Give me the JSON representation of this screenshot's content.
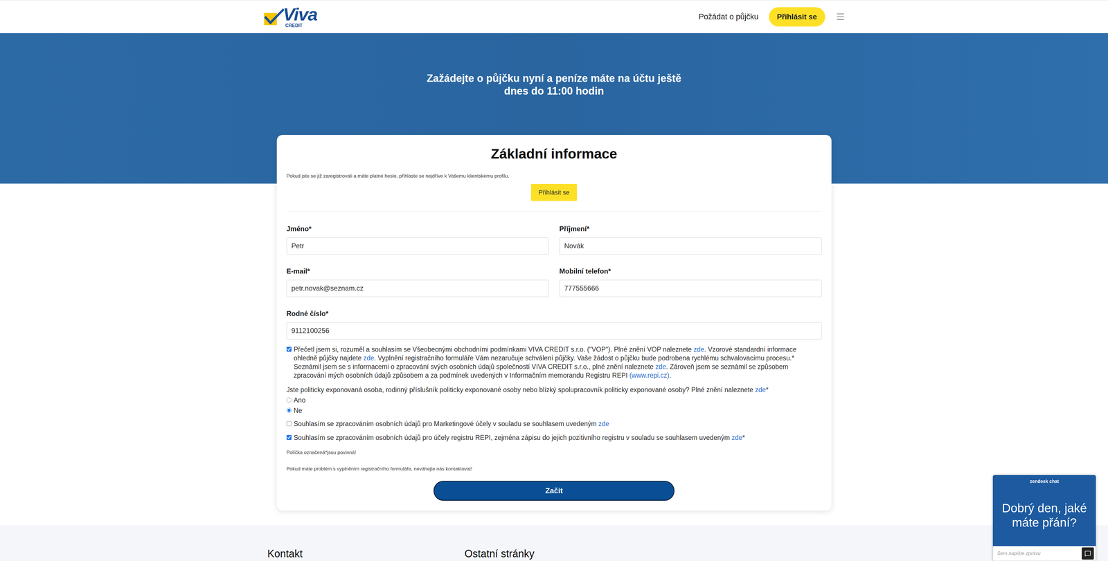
{
  "header": {
    "logo": {
      "name": "Viva",
      "sub": "CREDIT"
    },
    "nav": [
      {
        "label": "Požádat o půjčku"
      }
    ],
    "login_button": "Přihlásit se"
  },
  "hero": {
    "title_lines": [
      "Zažádejte o půjčku nyní a peníze máte na účtu ještě",
      "dnes do 11:00 hodin"
    ]
  },
  "form": {
    "title": "Základní informace",
    "login_hint": "Pokud jste se již zaregistrovali a máte platné heslo, přihlaste se nejdříve k Vašemu klientskému profilu.",
    "login_button": "Přihlásit se",
    "field_rows": [
      [
        {
          "label": "Jméno*",
          "value": "Petr"
        },
        {
          "label": "Příjmení*",
          "value": "Novák"
        }
      ],
      [
        {
          "label": "E-mail*",
          "value": "petr.novak@seznam.cz"
        },
        {
          "label": "Mobilní telefon*",
          "value": "777555666"
        }
      ],
      [
        {
          "label": "Rodné číslo*",
          "value": "9112100256"
        }
      ]
    ],
    "terms": {
      "checked": true,
      "paragraphs": [
        [
          {
            "text": "Přečetl jsem si, rozuměl a souhlasím se Všeobecnými obchodními podmínkami VIVA CREDIT s.r.o. (\"VOP\"). Plné znění VOP naleznete ",
            "link": false
          },
          {
            "text": "zde",
            "link": true
          },
          {
            "text": ". Vzorové standardní informace ohledně půjčky najdete ",
            "link": false
          },
          {
            "text": "zde",
            "link": true
          },
          {
            "text": ". Vyplnění registračního formuláře Vám nezaručuje schválení půjčky. Vaše žádost o půjčku bude podrobena rychlému schvalovacímu procesu.*",
            "link": false
          }
        ],
        [
          {
            "text": "Seznámil jsem se s informacemi o zpracování svých osobních údajů společností VIVA CREDIT s.r.o., plné znění naleznete ",
            "link": false
          },
          {
            "text": "zde",
            "link": true
          },
          {
            "text": ". Zároveň jsem se seznámil se způsobem zpracování mých osobních údajů způsobem a za podmínek uvedených v Informačním memorandu Registru REPI ",
            "link": false
          },
          {
            "text": "(www.repi.cz)",
            "link": true
          },
          {
            "text": ".",
            "link": false
          }
        ]
      ]
    },
    "pep": {
      "question": [
        {
          "text": "Jste politicky exponovaná osoba, rodinný příslušník politicky exponované osoby nebo blízký spolupracovník politicky exponované osoby? Plné znění naleznete ",
          "link": false
        },
        {
          "text": "zde",
          "link": true
        },
        {
          "text": "*",
          "link": false
        }
      ],
      "options": [
        {
          "label": "Ano",
          "selected": false
        },
        {
          "label": "Ne",
          "selected": true
        }
      ]
    },
    "consents": [
      {
        "checked": false,
        "parts": [
          {
            "text": "Souhlasím se zpracováním osobních údajů pro Marketingové účely v souladu se souhlasem uvedeným ",
            "link": false
          },
          {
            "text": "zde",
            "link": true
          }
        ]
      },
      {
        "checked": true,
        "parts": [
          {
            "text": "Souhlasím se zpracováním osobních údajů pro účely registru REPI, zejména zápisu do jejich pozitivního registru v souladu se souhlasem uvedeným ",
            "link": false
          },
          {
            "text": "zde",
            "link": true
          },
          {
            "text": "*",
            "link": false
          }
        ]
      }
    ],
    "notes": [
      "Políčka označená*jsou povinná!",
      "Pokud máte problém s vyplněním registračního formuláře, neváhejte nás kontaktovat!"
    ],
    "submit": "Začít"
  },
  "footer": {
    "headings": [
      "Kontakt",
      "Ostatní stránky"
    ]
  },
  "chat": {
    "brand": "zendesk chat",
    "greeting": "Dobrý den, jaké máte přání?",
    "placeholder": "Sem napište zprávu"
  }
}
